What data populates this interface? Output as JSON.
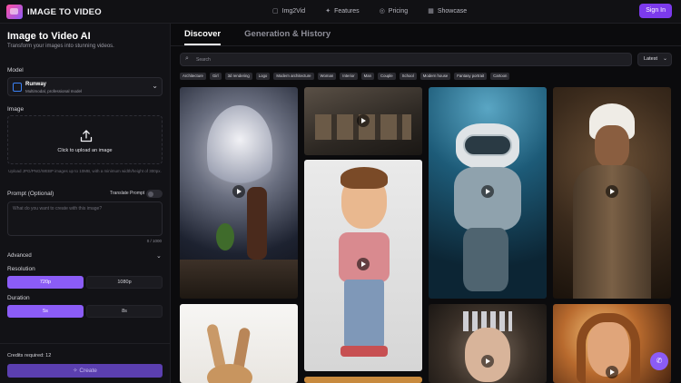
{
  "header": {
    "brand": "IMAGE TO VIDEO",
    "nav": [
      {
        "icon": "video-icon",
        "glyph": "▢",
        "label": "Img2Vid"
      },
      {
        "icon": "sparkle-icon",
        "glyph": "✦",
        "label": "Features"
      },
      {
        "icon": "pricing-icon",
        "glyph": "◎",
        "label": "Pricing"
      },
      {
        "icon": "grid-icon",
        "glyph": "▦",
        "label": "Showcase"
      }
    ],
    "signin": "Sign In"
  },
  "panel": {
    "title": "Image to Video AI",
    "subtitle": "Transform your images into stunning videos.",
    "model_label": "Model",
    "model_name": "Runway",
    "model_desc": "Multimodal, professional model",
    "image_label": "Image",
    "upload_text": "Click to upload an image",
    "upload_note": "Upload JPG/PNG/WEBP images up to 10MB, with a minimum width/height of 300px.",
    "prompt_label": "Prompt (Optional)",
    "translate_label": "Translate Prompt",
    "prompt_placeholder": "What do you want to create with this image?",
    "counter": "0 / 1000",
    "advanced_label": "Advanced",
    "resolution_label": "Resolution",
    "resolution_options": [
      "720p",
      "1080p"
    ],
    "resolution_selected": "720p",
    "duration_label": "Duration",
    "duration_options": [
      "5s",
      "8s"
    ],
    "duration_selected": "5s",
    "credits": "Credits required: 12",
    "create": "Create"
  },
  "content": {
    "tabs": [
      "Discover",
      "Generation & History"
    ],
    "active_tab": "Discover",
    "search_placeholder": "Search",
    "sort": "Latest",
    "tags": [
      "Architecture",
      "Girl",
      "3d rendering",
      "Logo",
      "Modern architecture",
      "Woman",
      "Interior",
      "Man",
      "Couple",
      "School",
      "Modern house",
      "Fantasy portrait",
      "Cartoon"
    ]
  },
  "colors": {
    "accent": "#8b5cf6",
    "signin": "#7c3aed",
    "background": "#0b0b0d"
  }
}
